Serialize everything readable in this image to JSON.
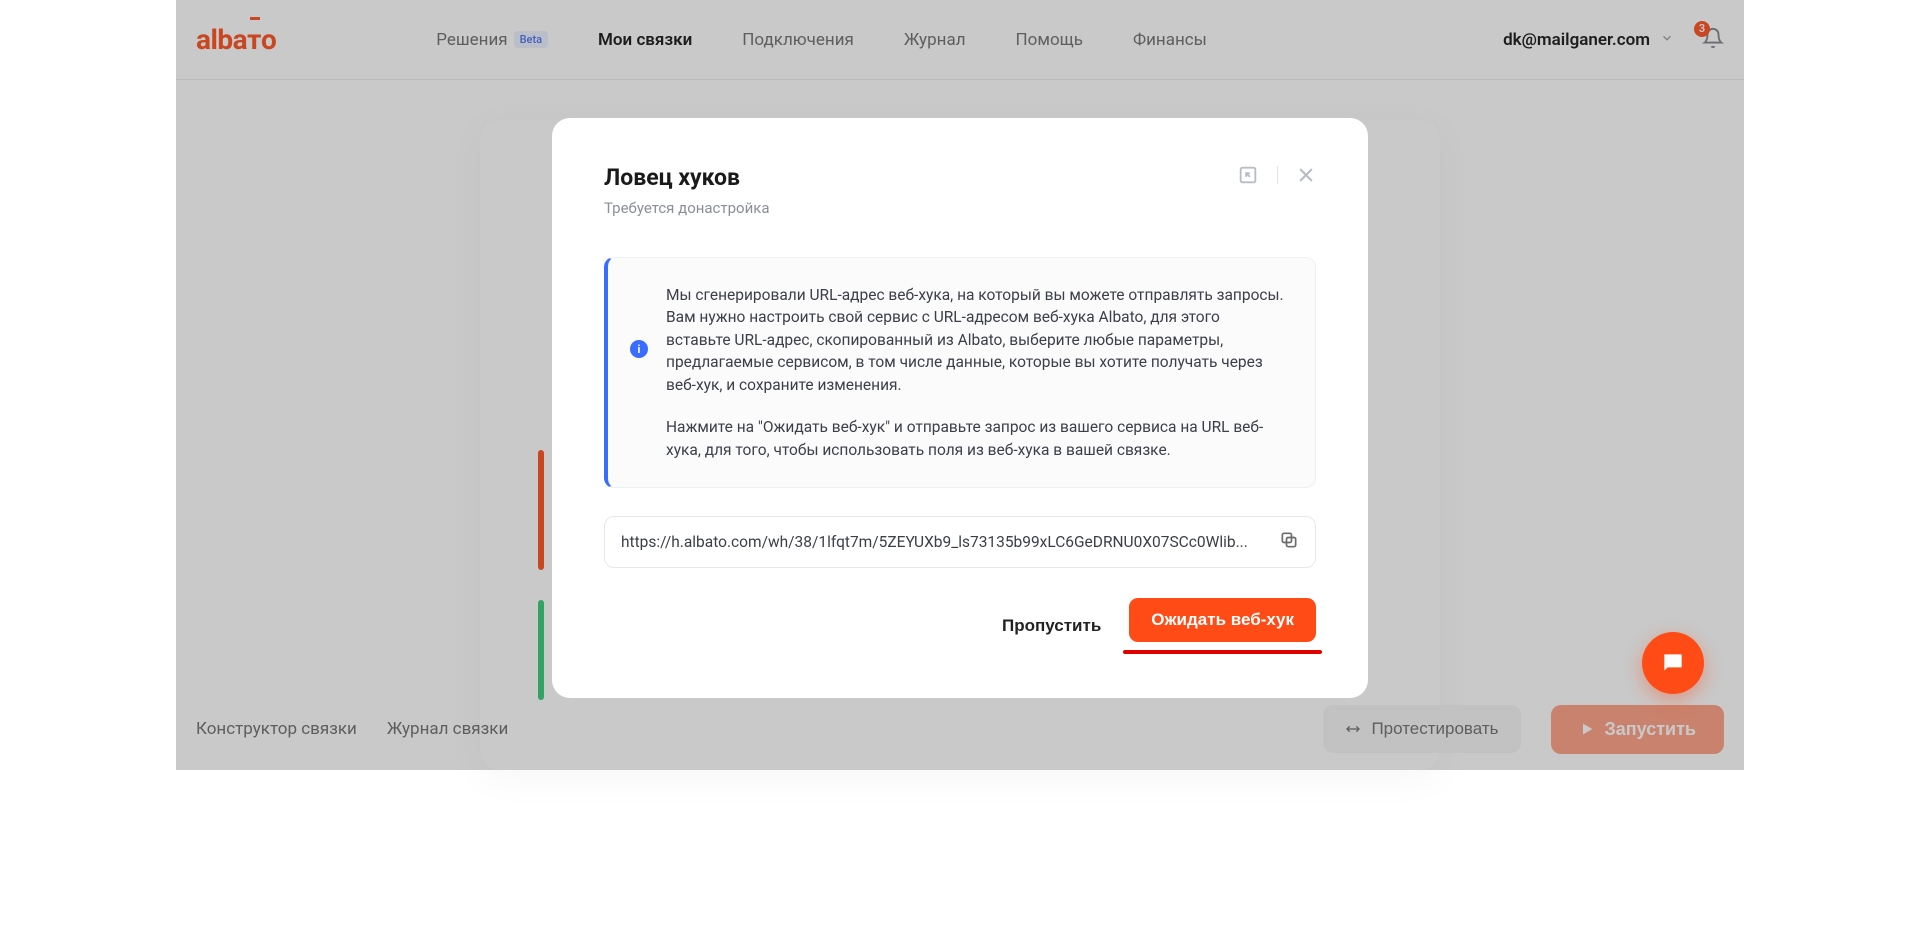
{
  "header": {
    "logo_text": "albato",
    "nav": [
      {
        "label": "Решения",
        "badge": "Beta"
      },
      {
        "label": "Мои связки",
        "active": true
      },
      {
        "label": "Подключения"
      },
      {
        "label": "Журнал"
      },
      {
        "label": "Помощь"
      },
      {
        "label": "Финансы"
      }
    ],
    "user_email": "dk@mailganer.com",
    "notif_count": "3"
  },
  "footer": {
    "builder": "Конструктор связки",
    "log": "Журнал связки",
    "test": "Протестировать",
    "run": "Запустить"
  },
  "modal": {
    "title": "Ловец хуков",
    "subtitle": "Требуется донастройка",
    "info_p1": "Мы сгенерировали URL-адрес веб-хука, на который вы можете отправлять запросы. Вам нужно настроить свой сервис с URL-адресом веб-хука Albato, для этого вставьте URL-адрес, скопированный из Albato, выберите любые параметры, предлагаемые сервисом, в том числе данные, которые вы хотите получать через веб-хук, и сохраните изменения.",
    "info_p2": "Нажмите на \"Ожидать веб-хук\" и отправьте запрос из вашего сервиса на URL веб-хука, для того, чтобы использовать поля из веб-хука в вашей связке.",
    "webhook_url": "https://h.albato.com/wh/38/1lfqt7m/5ZEYUXb9_ls73135b99xLC6GeDRNU0X07SCc0Wlib...",
    "skip": "Пропустить",
    "wait": "Ожидать веб-хук"
  }
}
